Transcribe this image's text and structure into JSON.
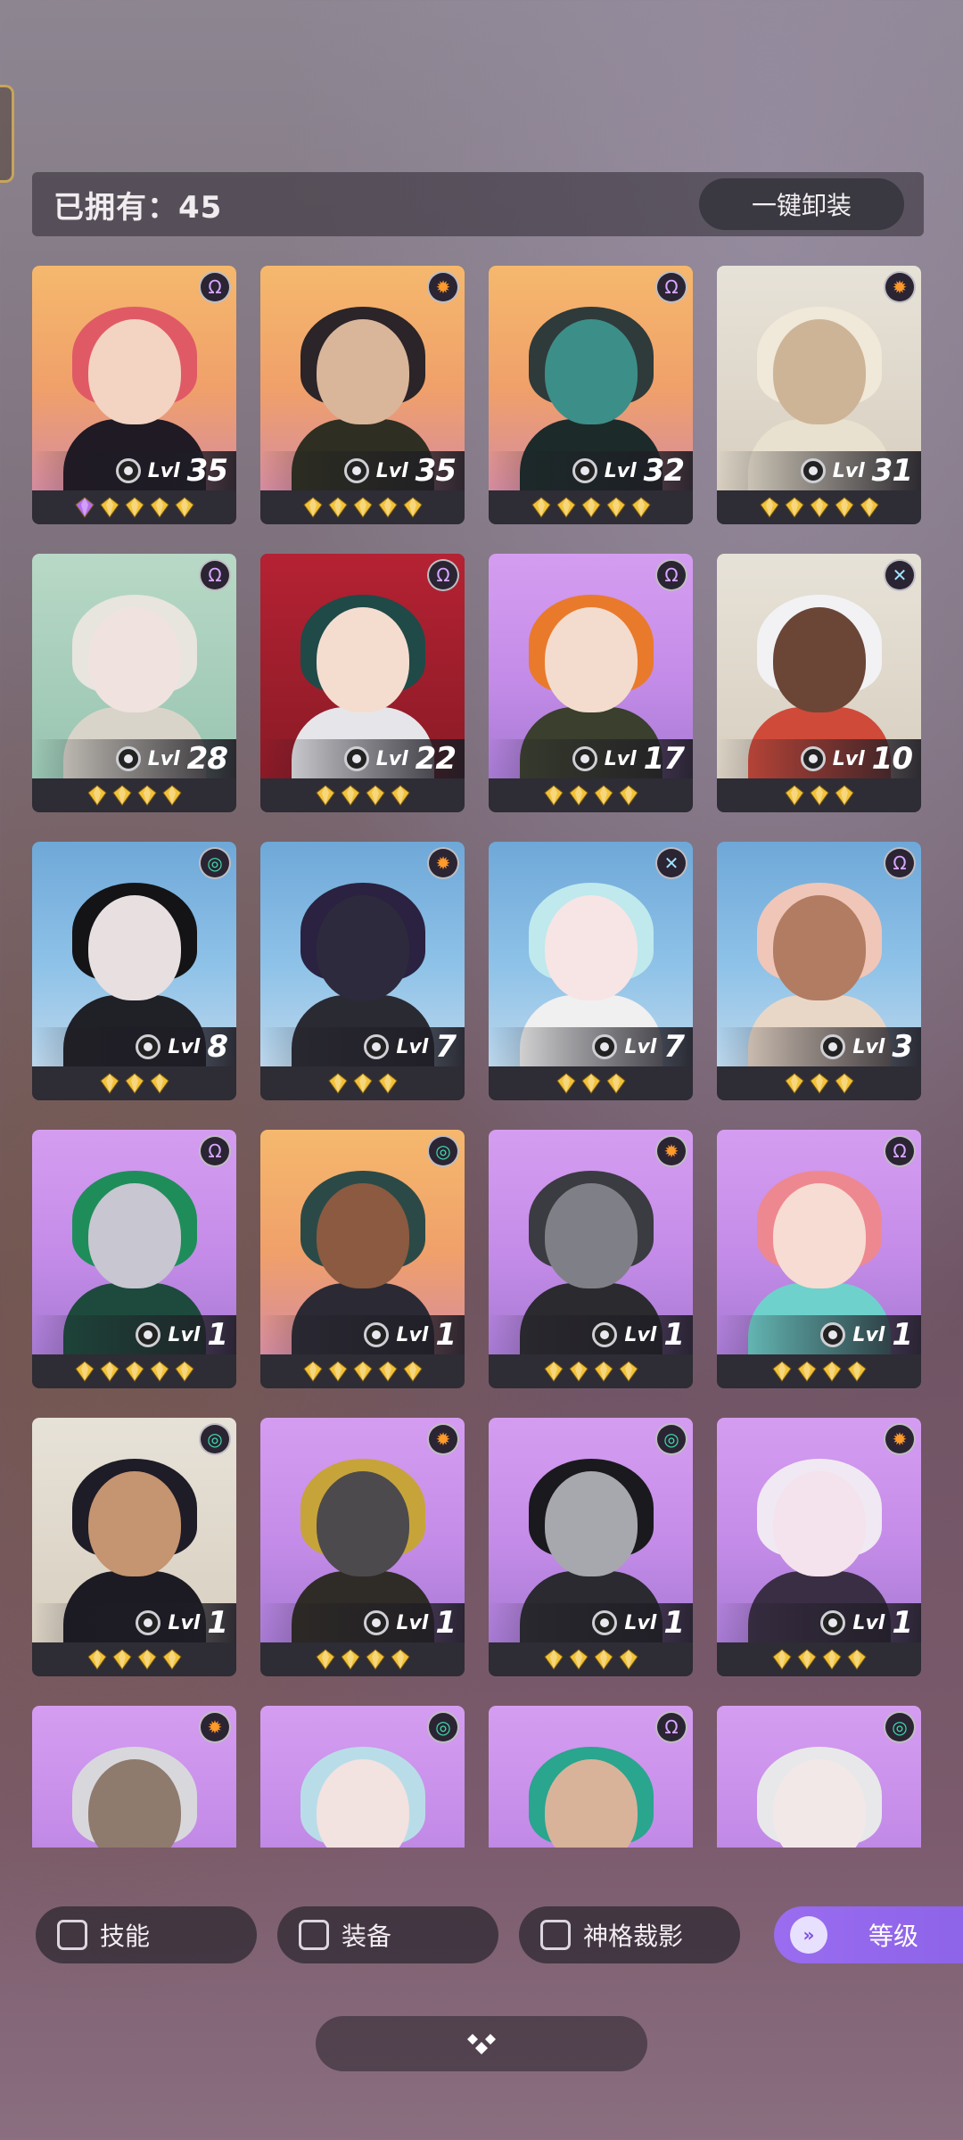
{
  "header": {
    "owned_label": "已拥有：45",
    "unequip_all_label": "一键卸装"
  },
  "colors": {
    "accent_purple": "#8b62e6",
    "gem_gold": "#f2c23a",
    "gem_purple": "#b66df0"
  },
  "heroes": [
    {
      "level": "35",
      "lvl_prefix": "Lvl",
      "faction": "void-icon",
      "bg": "bg-orange",
      "stars": 5,
      "purple_gems": 1,
      "hair": "#e05a66",
      "skin": "#f3d3c2",
      "outfit": "#1f1a24"
    },
    {
      "level": "35",
      "lvl_prefix": "Lvl",
      "faction": "sun-icon",
      "bg": "bg-orange",
      "stars": 5,
      "purple_gems": 0,
      "hair": "#2b2428",
      "skin": "#d9b59a",
      "outfit": "#2e2f22"
    },
    {
      "level": "32",
      "lvl_prefix": "Lvl",
      "faction": "void-icon",
      "bg": "bg-orange",
      "stars": 5,
      "purple_gems": 0,
      "hair": "#2f3a3a",
      "skin": "#3c8f88",
      "outfit": "#1c2b2a"
    },
    {
      "level": "31",
      "lvl_prefix": "Lvl",
      "faction": "sun-icon",
      "bg": "bg-cream",
      "stars": 5,
      "purple_gems": 0,
      "hair": "#f0e8d8",
      "skin": "#cdb497",
      "outfit": "#e9e1cf"
    },
    {
      "level": "28",
      "lvl_prefix": "Lvl",
      "faction": "void-icon",
      "bg": "bg-teal",
      "stars": 4,
      "purple_gems": 0,
      "hair": "#e8e4de",
      "skin": "#f0e3df",
      "outfit": "#d9d4ca"
    },
    {
      "level": "22",
      "lvl_prefix": "Lvl",
      "faction": "void-icon",
      "bg": "bg-red",
      "stars": 4,
      "purple_gems": 0,
      "hair": "#1f4a48",
      "skin": "#f4ddcf",
      "outfit": "#e6e6ea"
    },
    {
      "level": "17",
      "lvl_prefix": "Lvl",
      "faction": "void-icon",
      "bg": "bg-purple",
      "stars": 4,
      "purple_gems": 0,
      "hair": "#e97a2c",
      "skin": "#f3dccd",
      "outfit": "#3a3f2e"
    },
    {
      "level": "10",
      "lvl_prefix": "Lvl",
      "faction": "cross-icon",
      "bg": "bg-cream",
      "stars": 3,
      "purple_gems": 0,
      "hair": "#f2f2f4",
      "skin": "#6b4637",
      "outfit": "#d04a3a"
    },
    {
      "level": "8",
      "lvl_prefix": "Lvl",
      "faction": "wind-icon",
      "bg": "bg-blue",
      "stars": 3,
      "purple_gems": 0,
      "hair": "#141416",
      "skin": "#e8dfe0",
      "outfit": "#202027"
    },
    {
      "level": "7",
      "lvl_prefix": "Lvl",
      "faction": "sun-icon",
      "bg": "bg-blue",
      "stars": 3,
      "purple_gems": 0,
      "hair": "#2a2240",
      "skin": "#2e2a3d",
      "outfit": "#2a2a33"
    },
    {
      "level": "7",
      "lvl_prefix": "Lvl",
      "faction": "cross-icon",
      "bg": "bg-blue",
      "stars": 3,
      "purple_gems": 0,
      "hair": "#bfe9ec",
      "skin": "#f7e4e4",
      "outfit": "#f0f0f0"
    },
    {
      "level": "3",
      "lvl_prefix": "Lvl",
      "faction": "void-icon",
      "bg": "bg-blue",
      "stars": 3,
      "purple_gems": 0,
      "hair": "#f0c6b8",
      "skin": "#b27c62",
      "outfit": "#e8d7c7"
    },
    {
      "level": "1",
      "lvl_prefix": "Lvl",
      "faction": "void-icon",
      "bg": "bg-purple",
      "stars": 5,
      "purple_gems": 0,
      "hair": "#1f8d5a",
      "skin": "#c8c6d0",
      "outfit": "#1d4a3c"
    },
    {
      "level": "1",
      "lvl_prefix": "Lvl",
      "faction": "wind-icon",
      "bg": "bg-orange",
      "stars": 5,
      "purple_gems": 0,
      "hair": "#2b4a47",
      "skin": "#8b5a40",
      "outfit": "#2b2a34"
    },
    {
      "level": "1",
      "lvl_prefix": "Lvl",
      "faction": "sun-icon",
      "bg": "bg-purple",
      "stars": 4,
      "purple_gems": 0,
      "hair": "#3b3b42",
      "skin": "#7f8087",
      "outfit": "#2b2a2f"
    },
    {
      "level": "1",
      "lvl_prefix": "Lvl",
      "faction": "void-icon",
      "bg": "bg-purple",
      "stars": 4,
      "purple_gems": 0,
      "hair": "#ee8890",
      "skin": "#f6dcd2",
      "outfit": "#6fd1cc"
    },
    {
      "level": "1",
      "lvl_prefix": "Lvl",
      "faction": "wind-icon",
      "bg": "bg-cream",
      "stars": 4,
      "purple_gems": 0,
      "hair": "#1e1c27",
      "skin": "#c59470",
      "outfit": "#1c1a22"
    },
    {
      "level": "1",
      "lvl_prefix": "Lvl",
      "faction": "sun-icon",
      "bg": "bg-purple",
      "stars": 4,
      "purple_gems": 0,
      "hair": "#c7a43a",
      "skin": "#4d4a4d",
      "outfit": "#2f2b27"
    },
    {
      "level": "1",
      "lvl_prefix": "Lvl",
      "faction": "wind-icon",
      "bg": "bg-purple",
      "stars": 4,
      "purple_gems": 0,
      "hair": "#1a1a1e",
      "skin": "#a6a8ad",
      "outfit": "#2a2a30"
    },
    {
      "level": "1",
      "lvl_prefix": "Lvl",
      "faction": "sun-icon",
      "bg": "bg-purple",
      "stars": 4,
      "purple_gems": 0,
      "hair": "#f0e8f2",
      "skin": "#f4e2ec",
      "outfit": "#3a2e44"
    },
    {
      "level": "",
      "lvl_prefix": "",
      "faction": "sun-icon",
      "bg": "bg-purple",
      "stars": 0,
      "purple_gems": 0,
      "hair": "#d8d8dc",
      "skin": "#8f7a6e",
      "outfit": "#1f1d23"
    },
    {
      "level": "",
      "lvl_prefix": "",
      "faction": "wind-icon",
      "bg": "bg-purple",
      "stars": 0,
      "purple_gems": 0,
      "hair": "#b9dde8",
      "skin": "#f2e2e0",
      "outfit": "#2b2a33"
    },
    {
      "level": "",
      "lvl_prefix": "",
      "faction": "void-icon",
      "bg": "bg-purple",
      "stars": 0,
      "purple_gems": 0,
      "hair": "#2aa58e",
      "skin": "#d8b39a",
      "outfit": "#1b6e64"
    },
    {
      "level": "",
      "lvl_prefix": "",
      "faction": "wind-icon",
      "bg": "bg-purple",
      "stars": 0,
      "purple_gems": 0,
      "hair": "#e8e8ea",
      "skin": "#f2e8e8",
      "outfit": "#f6f6f8"
    }
  ],
  "filters": [
    {
      "label": "技能"
    },
    {
      "label": "装备"
    },
    {
      "label": "神格裁影"
    }
  ],
  "sort": {
    "label": "等级"
  }
}
